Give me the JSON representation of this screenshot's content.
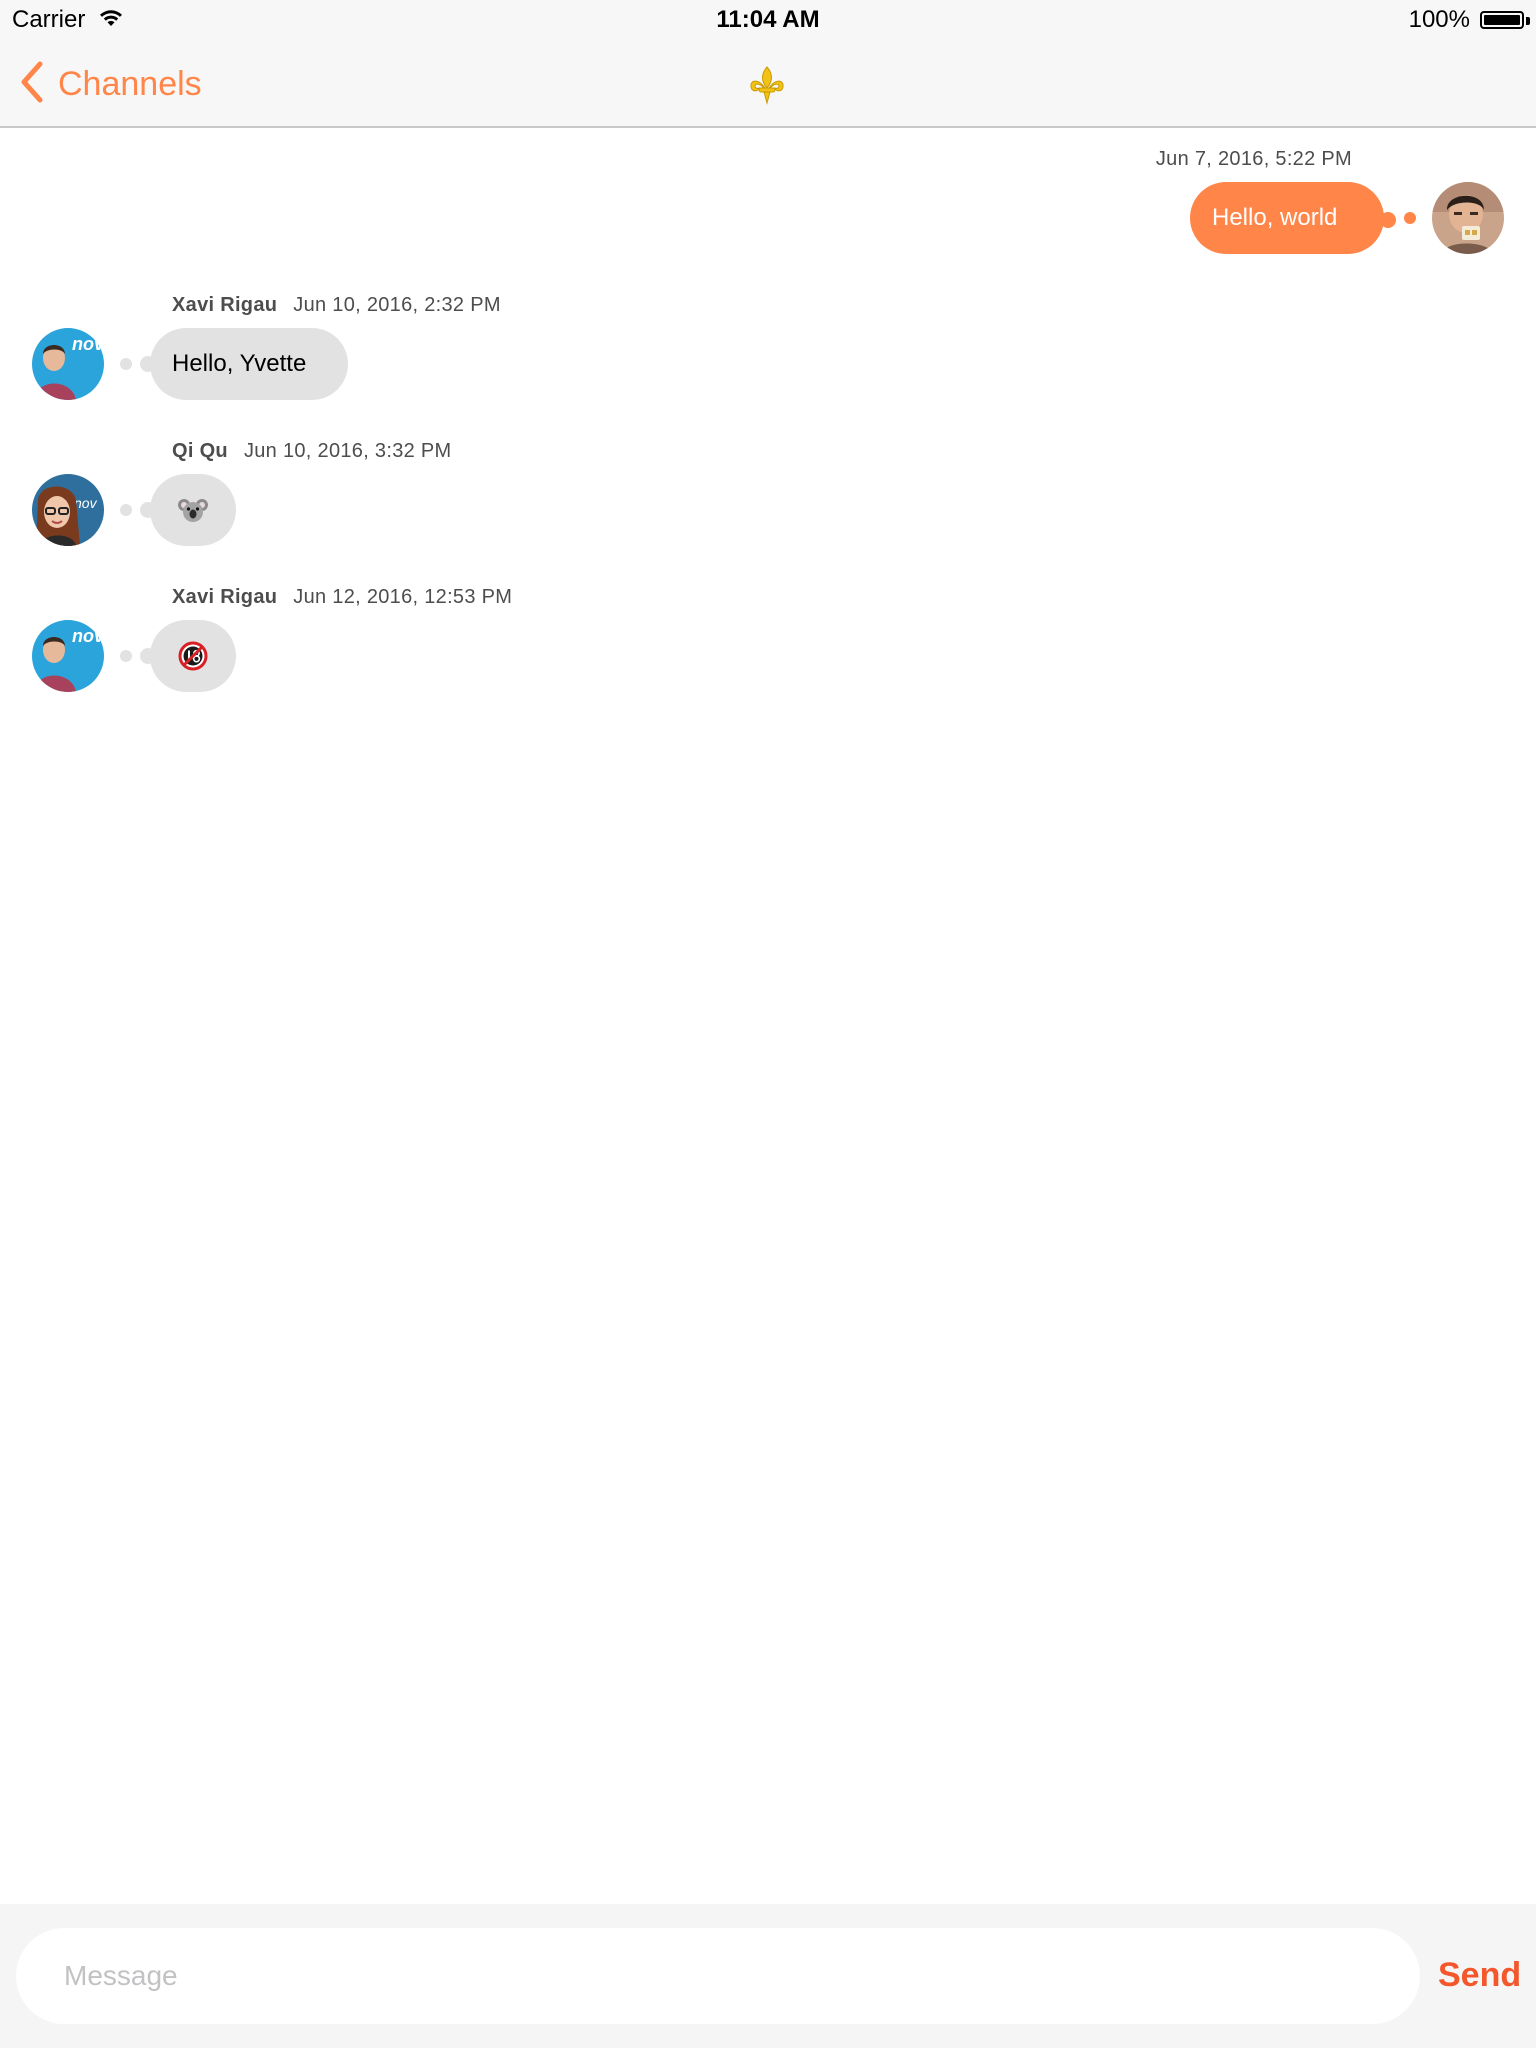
{
  "status_bar": {
    "carrier": "Carrier",
    "time": "11:04 AM",
    "battery": "100%"
  },
  "nav": {
    "back_label": "Channels",
    "title_icon": "fleur-de-lis-icon"
  },
  "colors": {
    "accent": "#ff8548",
    "send": "#f4572c",
    "incoming_bubble": "#e2e2e2"
  },
  "messages": [
    {
      "direction": "outgoing",
      "timestamp": "Jun 7, 2016, 5:22 PM",
      "text": "Hello, world"
    },
    {
      "direction": "incoming",
      "author": "Xavi Rigau",
      "timestamp": "Jun 10, 2016, 2:32 PM",
      "text": "Hello, Yvette"
    },
    {
      "direction": "incoming",
      "author": "Qi Qu",
      "timestamp": "Jun 10, 2016, 3:32 PM",
      "emoji": "koala-icon"
    },
    {
      "direction": "incoming",
      "author": "Xavi Rigau",
      "timestamp": "Jun 12, 2016, 12:53 PM",
      "emoji": "no-under-eighteen-icon"
    }
  ],
  "composer": {
    "placeholder": "Message",
    "value": "",
    "send_label": "Send"
  }
}
